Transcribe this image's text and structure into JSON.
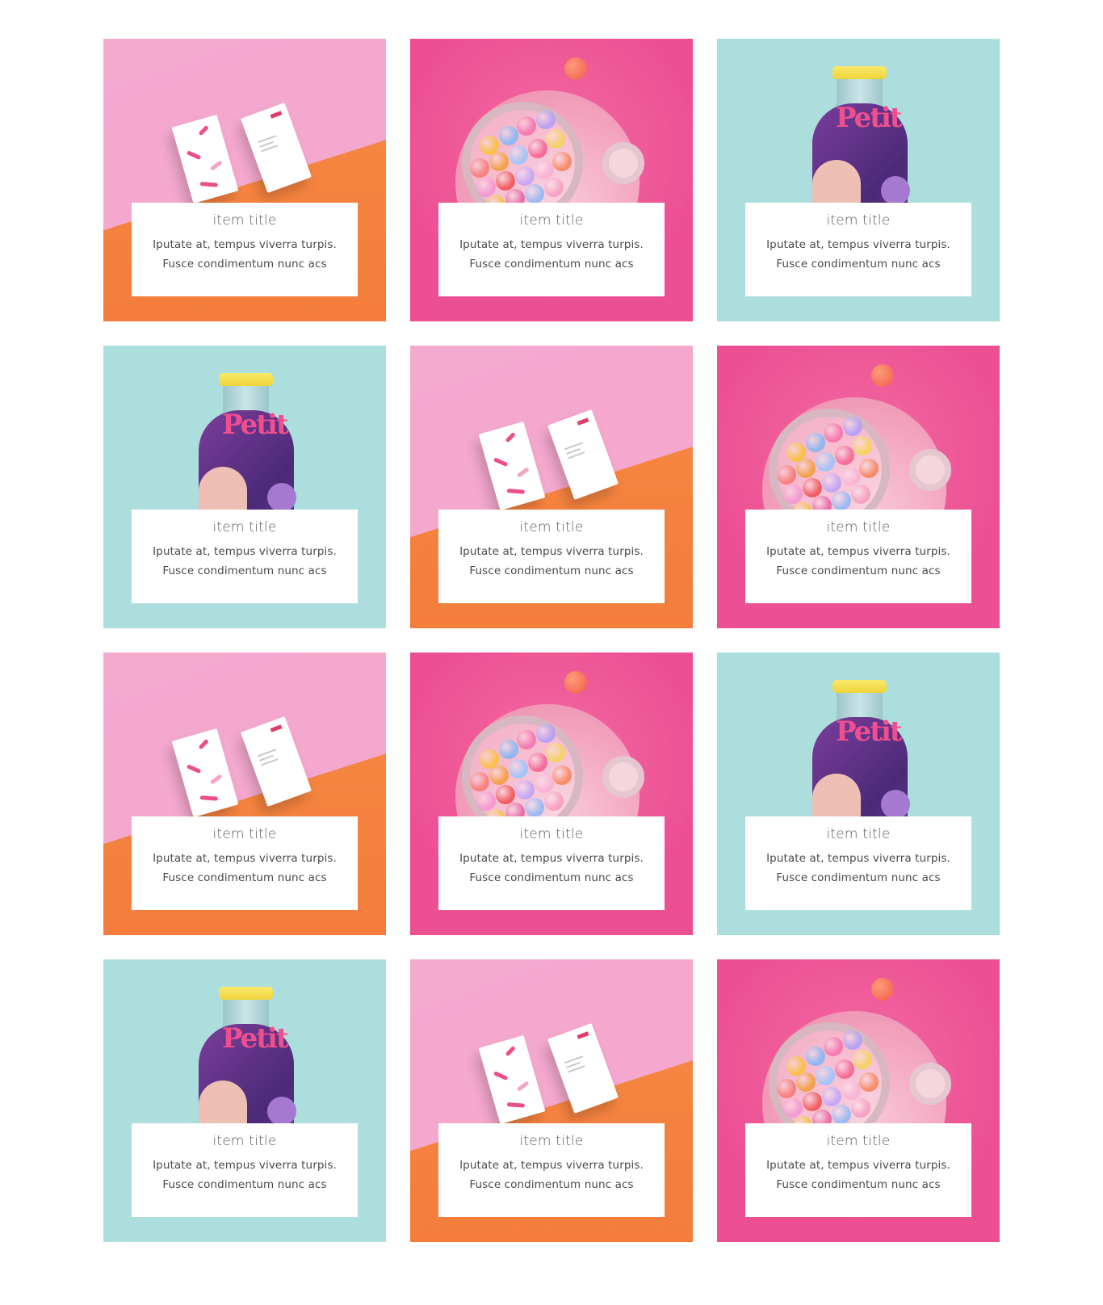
{
  "cards": [
    {
      "scene": "business-cards",
      "title": "item title",
      "description": "Iputate at, tempus viverra turpis. Fusce condimentum nunc acs"
    },
    {
      "scene": "gumball-helmet",
      "title": "item title",
      "description": "Iputate at, tempus viverra turpis. Fusce condimentum nunc acs"
    },
    {
      "scene": "juice-bottle",
      "title": "item title",
      "description": "Iputate at, tempus viverra turpis. Fusce condimentum nunc acs"
    },
    {
      "scene": "juice-bottle",
      "title": "item title",
      "description": "Iputate at, tempus viverra turpis. Fusce condimentum nunc acs"
    },
    {
      "scene": "business-cards",
      "title": "item title",
      "description": "Iputate at, tempus viverra turpis. Fusce condimentum nunc acs"
    },
    {
      "scene": "gumball-helmet",
      "title": "item title",
      "description": "Iputate at, tempus viverra turpis. Fusce condimentum nunc acs"
    },
    {
      "scene": "business-cards",
      "title": "item title",
      "description": "Iputate at, tempus viverra turpis. Fusce condimentum nunc acs"
    },
    {
      "scene": "gumball-helmet",
      "title": "item title",
      "description": "Iputate at, tempus viverra turpis. Fusce condimentum nunc acs"
    },
    {
      "scene": "juice-bottle",
      "title": "item title",
      "description": "Iputate at, tempus viverra turpis. Fusce condimentum nunc acs"
    },
    {
      "scene": "juice-bottle",
      "title": "item title",
      "description": "Iputate at, tempus viverra turpis. Fusce condimentum nunc acs"
    },
    {
      "scene": "business-cards",
      "title": "item title",
      "description": "Iputate at, tempus viverra turpis. Fusce condimentum nunc acs"
    },
    {
      "scene": "gumball-helmet",
      "title": "item title",
      "description": "Iputate at, tempus viverra turpis. Fusce condimentum nunc acs"
    }
  ],
  "colors": {
    "pink_light": "#f4a9cf",
    "orange": "#f58a42",
    "hot_pink": "#ec4f92",
    "teal": "#acdedd",
    "overlay_bg": "#ffffff"
  }
}
